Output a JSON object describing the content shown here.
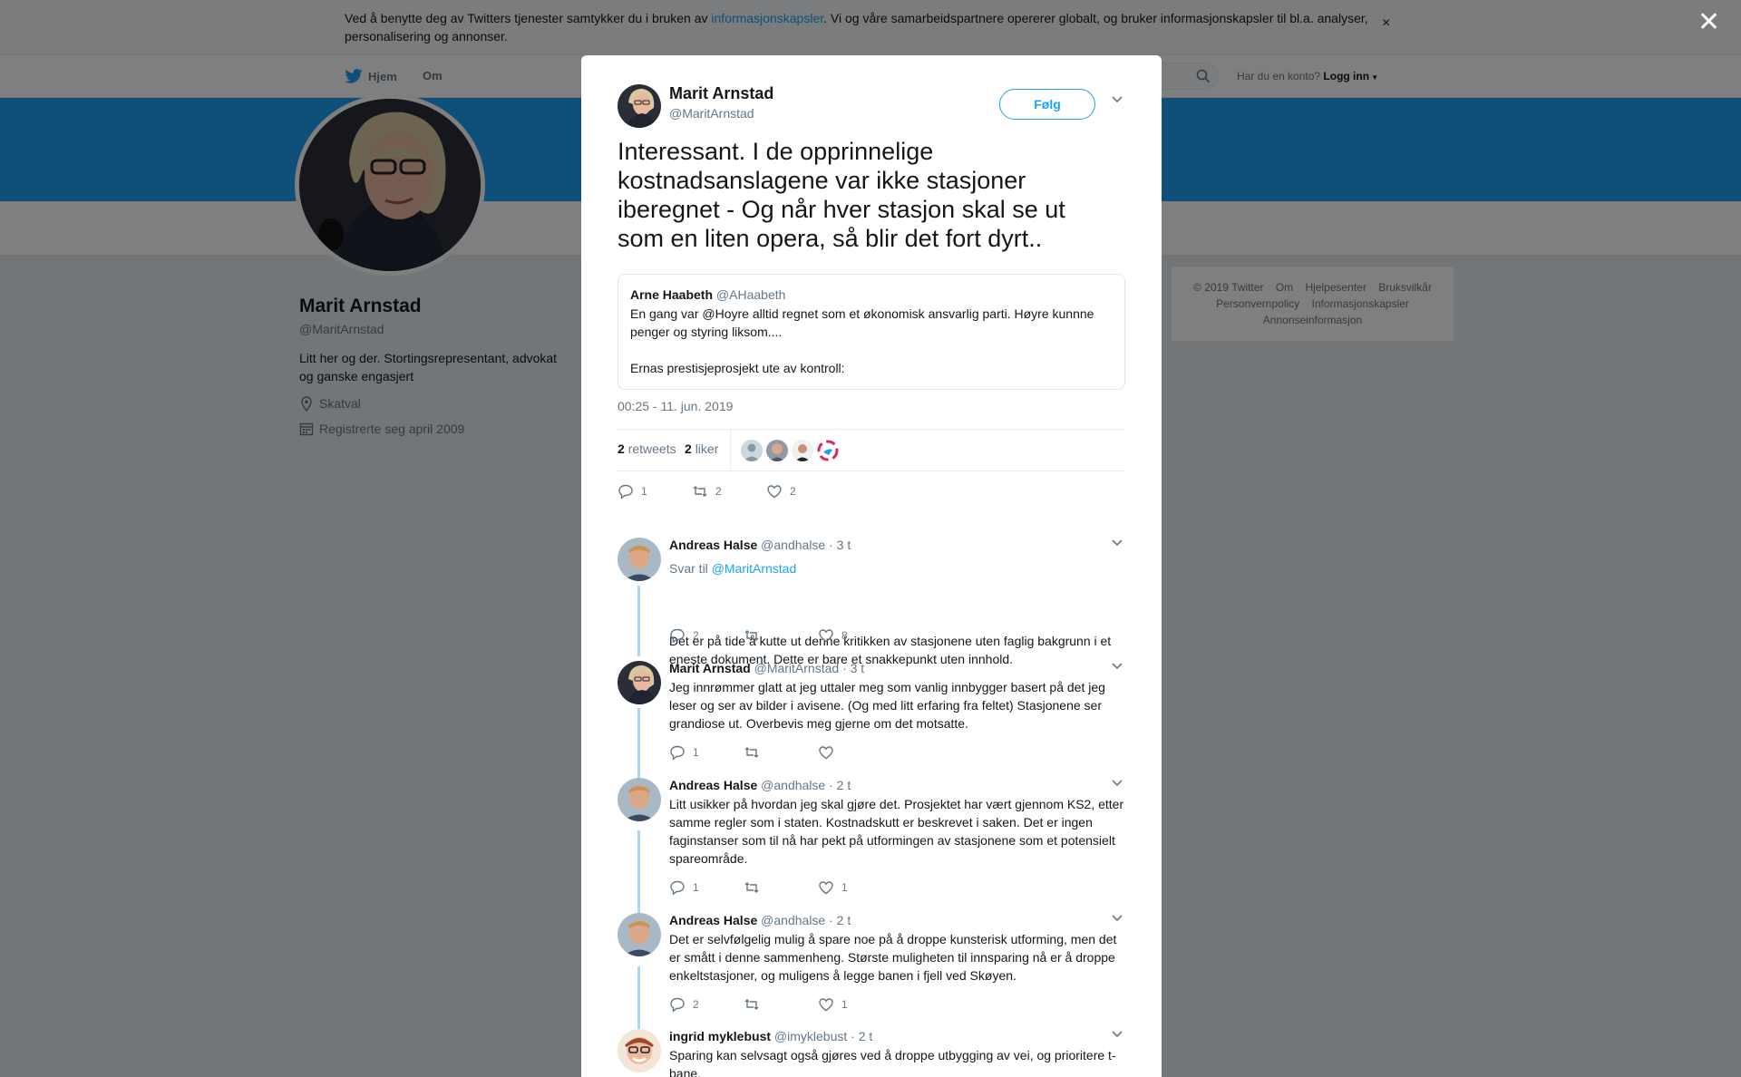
{
  "cookie_banner": {
    "text_before": "Ved å benytte deg av Twitters tjenester samtykker du i bruken av ",
    "link": "informasjonskapsler",
    "text_after": ". Vi og våre samarbeidspartnere opererer globalt, og bruker informasjonskapsler til bl.a. analyser, personalisering og annonser.",
    "close": "×"
  },
  "nav": {
    "home": "Hjem",
    "about": "Om",
    "account_prompt": "Har du en konto?",
    "login": "Logg inn"
  },
  "profile": {
    "name": "Marit Arnstad",
    "handle": "@MaritArnstad",
    "bio": "Litt her og der. Stortingsrepresentant, advokat og ganske engasjert",
    "location": "Skatval",
    "joined": "Registrerte seg april 2009"
  },
  "footer": {
    "line1": [
      "© 2019 Twitter",
      "Om",
      "Hjelpesenter",
      "Bruksvilkår"
    ],
    "line2": [
      "Personvernpolicy",
      "Informasjonskapsler"
    ],
    "line3": [
      "Annonseinformasjon"
    ]
  },
  "overlay_close": "✕",
  "tweet": {
    "name": "Marit Arnstad",
    "handle": "@MaritArnstad",
    "follow": "Følg",
    "text": "Interessant. I de opprinnelige kostnadsanslagene var ikke stasjoner iberegnet - Og når hver stasjon skal se ut som en liten opera, så blir det fort dyrt..",
    "quote": {
      "name": "Arne Haabeth",
      "handle": "@AHaabeth",
      "text1": "En gang var @Hoyre alltid regnet som et økonomisk ansvarlig parti. Høyre kunnne penger og styring liksom....",
      "text2": "Ernas prestisjeprosjekt ute av kontroll:"
    },
    "timestamp": "00:25 - 11. jun. 2019",
    "retweets_count": "2",
    "retweets_label": "retweets",
    "likes_count": "2",
    "likes_label": "liker",
    "actions": {
      "replies": "1",
      "retweets": "2",
      "likes": "2"
    }
  },
  "replies": [
    {
      "name": "Andreas Halse",
      "handle": "@andhalse",
      "time": "· 3 t",
      "reply_to_label": "Svar til",
      "reply_to": "@MaritArnstad",
      "text": "Det er på tide å kutte ut denne kritikken av stasjonene uten faglig bakgrunn i et eneste dokument. Dette er bare et snakkepunkt uten innhold.",
      "replies": "2",
      "retweets": "",
      "likes": "8"
    },
    {
      "name": "Marit Arnstad",
      "handle": "@MaritArnstad",
      "time": "· 3 t",
      "text": "Jeg innrømmer glatt at jeg uttaler meg som vanlig innbygger basert på det jeg leser og ser av bilder i avisene. (Og med litt erfaring fra feltet) Stasjonene ser grandiose ut. Overbevis meg gjerne om det motsatte.",
      "replies": "1",
      "retweets": "",
      "likes": ""
    },
    {
      "name": "Andreas Halse",
      "handle": "@andhalse",
      "time": "· 2 t",
      "text": "Litt usikker på hvordan jeg skal gjøre det. Prosjektet har vært gjennom KS2, etter samme regler som i staten. Kostnadskutt er beskrevet i saken. Det er ingen faginstanser som til nå har pekt på utformingen av stasjonene som et potensielt spareområde.",
      "replies": "1",
      "retweets": "",
      "likes": "1"
    },
    {
      "name": "Andreas Halse",
      "handle": "@andhalse",
      "time": "· 2 t",
      "text": "Det er selvfølgelig mulig å spare noe på å droppe kunsterisk utforming, men det er smått i denne sammenheng. Største muligheten til innsparing nå er å droppe enkeltstasjoner, og muligens å legge banen i fjell ved Skøyen.",
      "replies": "2",
      "retweets": "",
      "likes": "1"
    },
    {
      "name": "ingrid myklebust",
      "handle": "@imyklebust",
      "time": "· 2 t",
      "text": "Sparing kan selvsagt også gjøres ved å droppe utbygging av vei, og prioritere t-bane."
    }
  ]
}
